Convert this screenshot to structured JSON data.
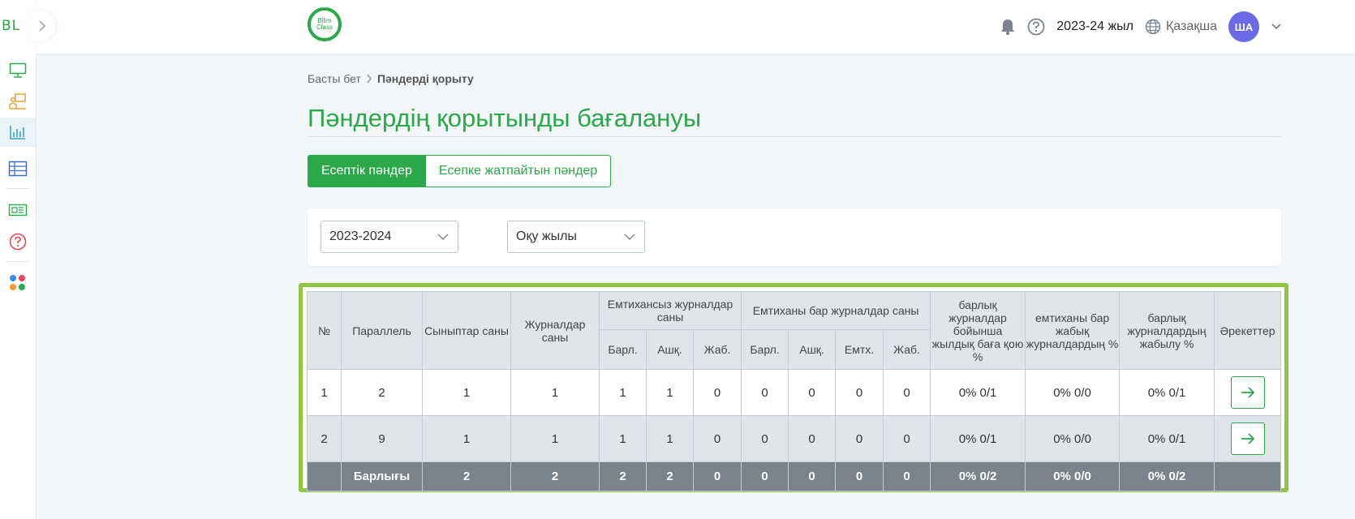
{
  "colors": {
    "accent": "#2aa84a",
    "highlight_border": "#8ec63f",
    "total_row": "#7a828b",
    "avatar": "#6a6ae8"
  },
  "sidebar": {
    "logo_text": "BL",
    "items": [
      {
        "icon": "monitor-icon"
      },
      {
        "icon": "teacher-board-icon"
      },
      {
        "icon": "bar-chart-icon",
        "active": true
      },
      {
        "icon": "table-icon"
      },
      {
        "icon": "newspaper-icon"
      },
      {
        "icon": "help-circle-icon"
      },
      {
        "icon": "apps-grid-icon"
      }
    ]
  },
  "header": {
    "logo_line1": "Bilim",
    "logo_line2": "Class",
    "year": "2023-24 жыл",
    "language": "Қазақша",
    "avatar_initials": "ША"
  },
  "breadcrumb": {
    "home": "Басты бет",
    "current": "Пәндерді қорыту"
  },
  "page_title": "Пәндердің қорытынды бағалануы",
  "tabs": {
    "active": "Есептік пәндер",
    "inactive": "Есепке жатпайтын пәндер"
  },
  "filters": {
    "year_value": "2023-2024",
    "period_value": "Оқу жылы"
  },
  "table": {
    "headers": {
      "num": "№",
      "parallel": "Параллель",
      "classes": "Сыныптар саны",
      "journals": "Журналдар саны",
      "no_exam_group": "Емтихансыз журналдар саны",
      "exam_group": "Емтиханы бар журналдар саны",
      "yearly_pct": "барлық журналдар бойынша жылдық баға қою %",
      "exam_closed_pct": "емтиханы бар жабық журналдардың %",
      "all_closed_pct": "барлық журналдардың жабылу %",
      "actions": "Әрекеттер",
      "sub_total": "Барл.",
      "sub_open": "Ашқ.",
      "sub_closed": "Жаб.",
      "sub_total2": "Барл.",
      "sub_open2": "Ашқ.",
      "sub_exam": "Емтх.",
      "sub_closed2": "Жаб."
    },
    "rows": [
      {
        "num": "1",
        "parallel": "2",
        "classes": "1",
        "journals": "1",
        "ne_total": "1",
        "ne_open": "1",
        "ne_closed": "0",
        "e_total": "0",
        "e_open": "0",
        "e_exam": "0",
        "e_closed": "0",
        "yearly_pct": "0% 0/1",
        "exam_closed_pct": "0% 0/0",
        "all_closed_pct": "0% 0/1"
      },
      {
        "num": "2",
        "parallel": "9",
        "classes": "1",
        "journals": "1",
        "ne_total": "1",
        "ne_open": "1",
        "ne_closed": "0",
        "e_total": "0",
        "e_open": "0",
        "e_exam": "0",
        "e_closed": "0",
        "yearly_pct": "0% 0/1",
        "exam_closed_pct": "0% 0/0",
        "all_closed_pct": "0% 0/1"
      }
    ],
    "total": {
      "label": "Барлығы",
      "classes": "2",
      "journals": "2",
      "ne_total": "2",
      "ne_open": "2",
      "ne_closed": "0",
      "e_total": "0",
      "e_open": "0",
      "e_exam": "0",
      "e_closed": "0",
      "yearly_pct": "0% 0/2",
      "exam_closed_pct": "0% 0/0",
      "all_closed_pct": "0% 0/2"
    }
  }
}
